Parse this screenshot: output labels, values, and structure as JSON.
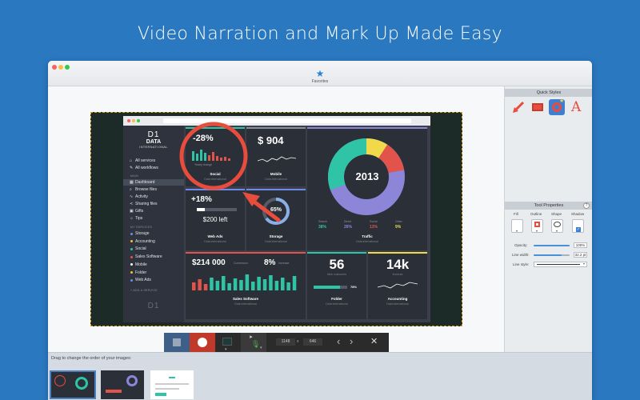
{
  "headline": "Video Narration and Mark Up Made Easy",
  "window": {
    "favorites_label": "Favorites",
    "drag_hint": "Drag to change the order of your images:"
  },
  "recorder": {
    "width": "1148",
    "times": "x",
    "height": "646"
  },
  "dashboard": {
    "logo_d1": "D1",
    "logo_data": "DATA",
    "logo_intl": "INTERNATIONAL",
    "nav_top": [
      "All services",
      "All workflows"
    ],
    "nav_main_head": "MAIN",
    "nav_main": [
      "Dashboard",
      "Browse files",
      "Activity",
      "Sharing files",
      "Gifts",
      "Tips"
    ],
    "nav_services_head": "MY SERVICES",
    "nav_services": [
      {
        "label": "Storage",
        "color": "#6f8be8"
      },
      {
        "label": "Accounting",
        "color": "#f2c232"
      },
      {
        "label": "Social",
        "color": "#2fc4a6"
      },
      {
        "label": "Sales Software",
        "color": "#e2544b"
      },
      {
        "label": "Mobile",
        "color": "#ffffff"
      },
      {
        "label": "Folder",
        "color": "#f2c232"
      },
      {
        "label": "Web Ads",
        "color": "#6f8be8"
      }
    ],
    "nav_add": "+ ADD A SERVICE",
    "footer_logo": "D1",
    "social": {
      "value": "-28%",
      "note": "Yearly change",
      "title": "Social",
      "sub": "Data international"
    },
    "mobile": {
      "value": "$ 904",
      "title": "Mobile",
      "sub": "Data international"
    },
    "traffic": {
      "year": "2013",
      "title": "Traffic",
      "sub": "Data international",
      "legend": [
        {
          "label": "Search",
          "value": "38%",
          "color": "#2fc4a6"
        },
        {
          "label": "Direct",
          "value": "26%",
          "color": "#8c86d9"
        },
        {
          "label": "Social",
          "value": "13%",
          "color": "#e2544b"
        },
        {
          "label": "Other",
          "value": "9%",
          "color": "#f2d94a"
        }
      ]
    },
    "webads": {
      "value": "+18%",
      "left": "$200 left",
      "title": "Web Ads",
      "sub": "Data international"
    },
    "storage": {
      "value": "65%",
      "title": "Storage",
      "sub": "Data international"
    },
    "sales": {
      "value": "$214 000",
      "value_note": "Conversion",
      "pct": "8%",
      "pct_note": "Increase",
      "title": "Sales Software",
      "sub": "Data international"
    },
    "folder": {
      "value": "56",
      "note": "New customers",
      "bar_pct": "78%",
      "title": "Folder",
      "sub": "Data international"
    },
    "accounting": {
      "value": "14k",
      "note": "Invoices",
      "title": "Accounting",
      "sub": "Data international"
    }
  },
  "quick_styles": {
    "title": "Quick Styles"
  },
  "tool_properties": {
    "title": "Tool Properties",
    "help": "?",
    "columns": [
      "Fill",
      "Outline",
      "Shape",
      "Shadow"
    ],
    "opacity_label": "Opacity:",
    "opacity_value": "100%",
    "opacity_level": 1.0,
    "linewidth_label": "Line width:",
    "linewidth_value": "32.2 pt",
    "linewidth_level": 0.78,
    "linestyle_label": "Line style:"
  },
  "colors": {
    "accent_blue": "#2a78c0",
    "annotation_red": "#e84c3d",
    "teal": "#2fc4a6",
    "purple": "#8c86d9",
    "yellow": "#f2d94a"
  }
}
